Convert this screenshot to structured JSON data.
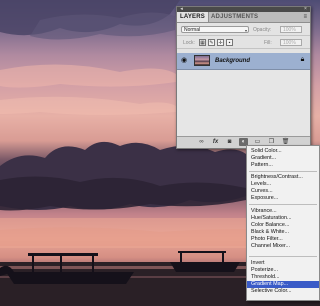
{
  "layers_panel": {
    "tabs": [
      {
        "label": "LAYERS",
        "active": true
      },
      {
        "label": "ADJUSTMENTS",
        "active": false
      }
    ],
    "blend_mode": "Normal",
    "opacity_label": "Opacity:",
    "opacity_value": "100%",
    "lock_label": "Lock:",
    "fill_label": "Fill:",
    "fill_value": "100%",
    "layers": [
      {
        "name": "Background",
        "visible": true,
        "locked": true,
        "selected": true
      }
    ],
    "bottom_icons": [
      "link-layers-icon",
      "fx-icon",
      "layer-mask-icon",
      "new-adjustment-layer-icon",
      "folder-icon",
      "new-layer-icon",
      "trash-icon"
    ],
    "fx_label": "fx",
    "menu_label": "≡"
  },
  "adjustment_menu": {
    "groups": [
      [
        "Solid Color...",
        "Gradient...",
        "Pattern..."
      ],
      [
        "Brightness/Contrast...",
        "Levels...",
        "Curves...",
        "Exposure..."
      ],
      [
        "Vibrance...",
        "Hue/Saturation...",
        "Color Balance...",
        "Black & White...",
        "Photo Filter...",
        "Channel Mixer..."
      ],
      [
        "Invert",
        "Posterize...",
        "Threshold...",
        "Gradient Map...",
        "Selective Color..."
      ]
    ],
    "highlighted": "Gradient Map..."
  },
  "colors": {
    "panel_bg": "#e3e3e3",
    "selected_layer": "#9cb0d0",
    "menu_highlight": "#3a5bc7"
  }
}
